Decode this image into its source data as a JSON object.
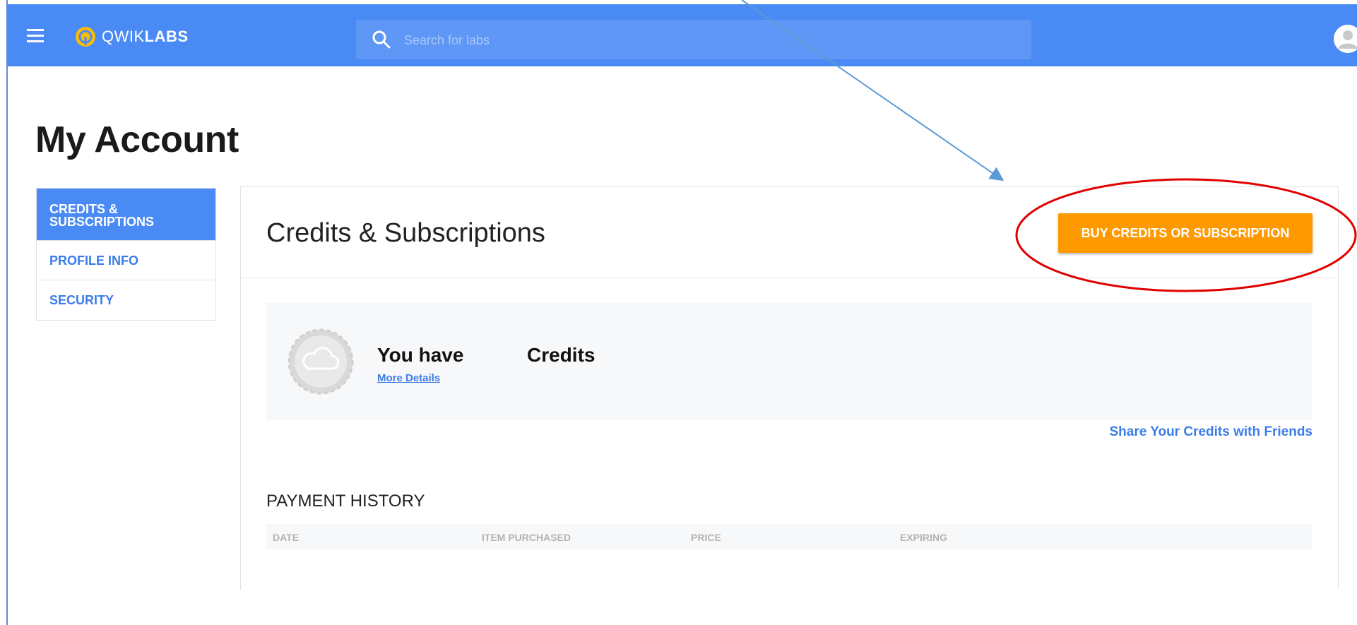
{
  "colors": {
    "topbar": "#4a8af4",
    "accent": "#3c7ce8",
    "buy_button": "#ff9900",
    "annotation_arrow": "#5b9bd5",
    "annotation_circle": "#e00000"
  },
  "header": {
    "menu_icon": "hamburger-icon",
    "logo": {
      "prefix": "QWIK",
      "bold": "LABS"
    },
    "search": {
      "placeholder": "Search for labs",
      "value": "",
      "icon": "search-icon"
    },
    "avatar_icon": "user-avatar-icon"
  },
  "page": {
    "title": "My Account"
  },
  "sidebar": {
    "items": [
      {
        "line1": "CREDITS &",
        "line2": "SUBSCRIPTIONS",
        "active": true
      },
      {
        "label": "PROFILE INFO",
        "active": false
      },
      {
        "label": "SECURITY",
        "active": false
      }
    ]
  },
  "credits_section": {
    "title": "Credits & Subscriptions",
    "buy_button": "BUY CREDITS OR SUBSCRIPTION",
    "you_have": "You have",
    "credits_word": "Credits",
    "more_details": "More Details",
    "share_link": "Share Your Credits with Friends"
  },
  "payment_history": {
    "title": "PAYMENT HISTORY",
    "columns": [
      "DATE",
      "ITEM PURCHASED",
      "PRICE",
      "EXPIRING"
    ]
  }
}
